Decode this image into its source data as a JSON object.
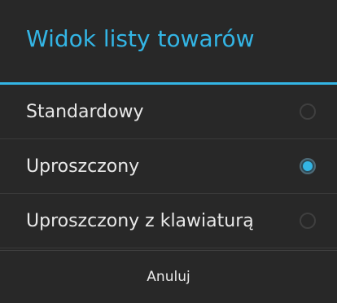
{
  "dialog": {
    "title": "Widok listy towarów",
    "options": [
      {
        "label": "Standardowy",
        "selected": false
      },
      {
        "label": "Uproszczony",
        "selected": true
      },
      {
        "label": "Uproszczony z klawiaturą",
        "selected": false
      }
    ],
    "cancel_label": "Anuluj"
  },
  "colors": {
    "accent": "#33b5e5",
    "background": "#282828",
    "text": "#e8e8e8"
  }
}
